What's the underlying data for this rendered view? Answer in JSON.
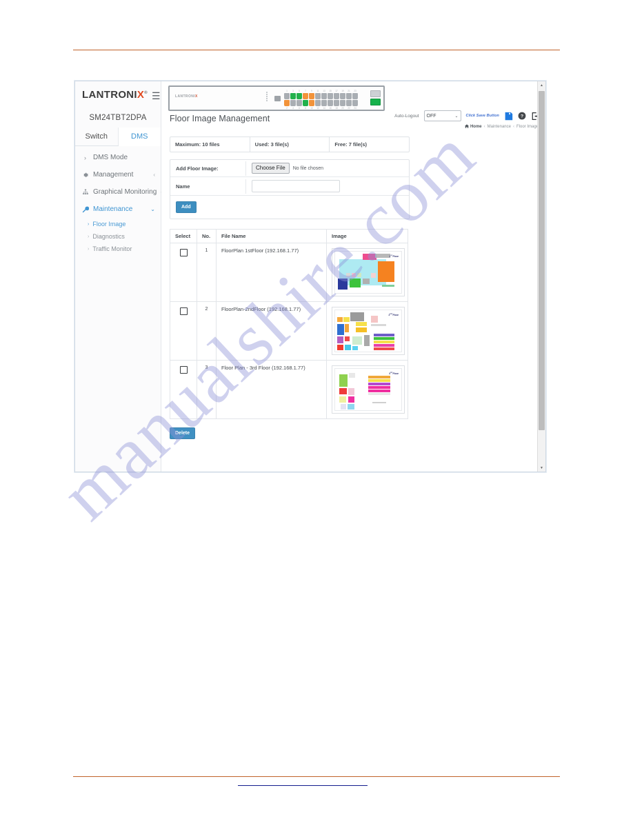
{
  "document": {
    "rule_color": "#c0622a",
    "footer_link_color": "#111a8c",
    "watermark_text": "manualshire.com"
  },
  "sidebar": {
    "logo_text": "LANTRONI",
    "logo_accent_letter": "X",
    "logo_registered": "®",
    "model": "SM24TBT2DPA",
    "hamburger_icon": "hamburger-icon",
    "tabs": [
      {
        "label": "Switch",
        "active": false
      },
      {
        "label": "DMS",
        "active": true
      }
    ],
    "items": [
      {
        "label": "DMS Mode",
        "icon": "chevron-right-icon",
        "chevron": "",
        "active": false,
        "type": "top"
      },
      {
        "label": "Management",
        "icon": "gear-icon",
        "chevron": "‹",
        "active": false,
        "type": "top"
      },
      {
        "label": "Graphical Monitoring",
        "icon": "sitemap-icon",
        "chevron": "‹",
        "active": false,
        "type": "top"
      },
      {
        "label": "Maintenance",
        "icon": "wrench-icon",
        "chevron": "⌄",
        "active": true,
        "type": "top"
      },
      {
        "label": "Floor Image",
        "icon": "chevron-right-icon",
        "active": true,
        "type": "sub"
      },
      {
        "label": "Diagnostics",
        "icon": "chevron-right-icon",
        "active": false,
        "type": "sub"
      },
      {
        "label": "Traffic Monitor",
        "icon": "chevron-right-icon",
        "active": false,
        "type": "sub"
      }
    ]
  },
  "topbar": {
    "device_logo": "LANTRONI",
    "device_logo_accent": "X",
    "auto_logout_label": "Auto-Logout",
    "auto_logout_value": "OFF",
    "save_hint": "Click Save Button",
    "save_icon": "floppy-save-icon",
    "help_icon": "question-circle-icon",
    "logout_icon": "logout-icon",
    "ports": {
      "top_numbers": [
        "1",
        "3",
        "5",
        "7",
        "9",
        "11",
        "13",
        "15",
        "17",
        "19",
        "21",
        "23"
      ],
      "bottom_numbers": [
        "2",
        "4",
        "6",
        "8",
        "10",
        "12",
        "14",
        "16",
        "18",
        "20",
        "22",
        "24"
      ],
      "sfp_numbers": [
        "25",
        "26"
      ],
      "colors": [
        "gray",
        "green",
        "green",
        "orange",
        "orange",
        "gray",
        "gray",
        "gray",
        "gray",
        "gray",
        "gray",
        "gray"
      ],
      "bottom_colors": [
        "orange",
        "gray",
        "gray",
        "green",
        "orange",
        "gray",
        "gray",
        "gray",
        "gray",
        "gray",
        "gray",
        "gray"
      ]
    }
  },
  "breadcrumb": {
    "home_icon": "home-icon",
    "items": [
      "Home",
      "Maintenance",
      "Floor Image"
    ],
    "separator": "‹"
  },
  "page": {
    "title": "Floor Image Management"
  },
  "quota": {
    "maximum": "Maximum: 10 files",
    "used": "Used: 3 file(s)",
    "free": "Free: 7 file(s)"
  },
  "add_form": {
    "file_label": "Add Floor Image:",
    "choose_button": "Choose File",
    "no_file_text": "No file chosen",
    "name_label": "Name",
    "name_value": "",
    "name_placeholder": "",
    "add_button": "Add"
  },
  "table": {
    "headers": [
      "Select",
      "No.",
      "File Name",
      "Image"
    ],
    "rows": [
      {
        "no": "1",
        "file_name": "FloorPlan 1stFloor (192.168.1.77)",
        "checked": false,
        "thumb_tag": "1",
        "thumb_tag_sup": "st",
        "thumb_tag_suffix": " Floor"
      },
      {
        "no": "2",
        "file_name": "FloorPlan-2ndFloor (192.168.1.77)",
        "checked": false,
        "thumb_tag": "2",
        "thumb_tag_sup": "nd",
        "thumb_tag_suffix": " Floor"
      },
      {
        "no": "3",
        "file_name": "Floor Plan - 3rd Floor (192.168.1.77)",
        "checked": false,
        "thumb_tag": "3",
        "thumb_tag_sup": "rd",
        "thumb_tag_suffix": " Floor"
      }
    ],
    "delete_button": "Delete"
  },
  "scrollbar": {
    "up_arrow": "▲",
    "down_arrow": "▼"
  },
  "colors": {
    "accent_blue": "#3f95d2",
    "button_blue": "#3f8fc0",
    "rule_orange": "#c0622a",
    "port_green": "#23b14c",
    "port_orange": "#f2933a"
  }
}
